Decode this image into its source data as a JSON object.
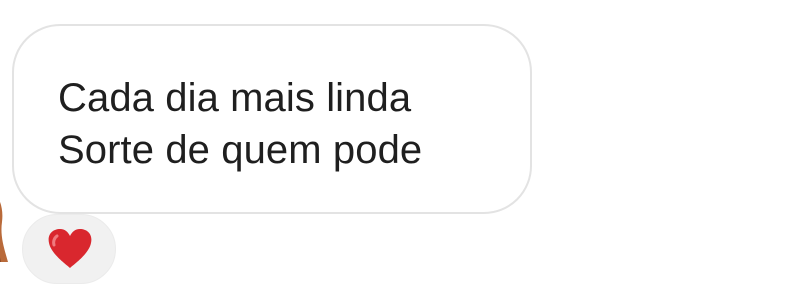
{
  "message": {
    "lines": [
      "Cada dia mais linda",
      "Sorte de quem pode"
    ]
  },
  "reaction": {
    "emoji_icon": "red-heart-icon",
    "color": "#d9272e"
  },
  "avatar": {
    "icon": "avatar-photo"
  },
  "colors": {
    "background": "#ffffff",
    "bubble_border": "#e3e3e3",
    "text": "#1f1f1f",
    "reaction_pill": "#f1f1f1"
  }
}
